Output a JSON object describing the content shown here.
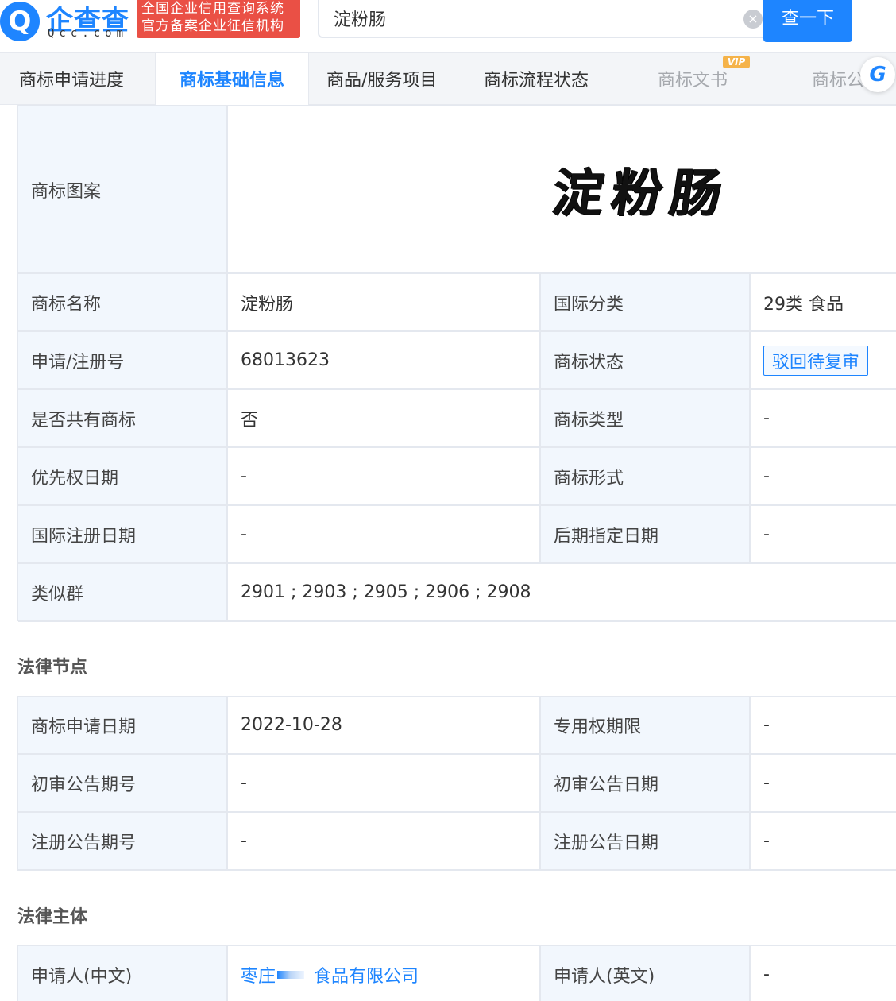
{
  "header": {
    "logo_glyph": "Q",
    "logo_text": "企查查",
    "logo_sub": "Qcc.com",
    "badge_line1": "全国企业信用查询系统",
    "badge_line2": "官方备案企业征信机构",
    "search_value": "淀粉肠",
    "search_button": "查一下",
    "clear_glyph": "×"
  },
  "tabs": {
    "items": [
      {
        "label": "商标申请进度"
      },
      {
        "label": "商标基础信息"
      },
      {
        "label": "商品/服务项目"
      },
      {
        "label": "商标流程状态"
      },
      {
        "label": "商标文书"
      },
      {
        "label": "商标公"
      }
    ],
    "vip_badge": "VIP",
    "assistant_glyph": "G"
  },
  "basic": {
    "pattern_label": "商标图案",
    "pattern_text": "淀粉肠",
    "name_label": "商标名称",
    "name_value": "淀粉肠",
    "intl_class_label": "国际分类",
    "intl_class_value": "29类 食品",
    "reg_no_label": "申请/注册号",
    "reg_no_value": "68013623",
    "status_label": "商标状态",
    "status_value": "驳回待复审",
    "shared_label": "是否共有商标",
    "shared_value": "否",
    "type_label": "商标类型",
    "type_value": "-",
    "priority_label": "优先权日期",
    "priority_value": "-",
    "form_label": "商标形式",
    "form_value": "-",
    "intl_reg_label": "国际注册日期",
    "intl_reg_value": "-",
    "later_label": "后期指定日期",
    "later_value": "-",
    "similar_label": "类似群",
    "similar_value": "2901 ; 2903 ; 2905 ; 2906 ; 2908"
  },
  "legal_nodes": {
    "title": "法律节点",
    "apply_date_label": "商标申请日期",
    "apply_date_value": "2022-10-28",
    "exclusive_label": "专用权期限",
    "exclusive_value": "-",
    "prelim_no_label": "初审公告期号",
    "prelim_no_value": "-",
    "prelim_date_label": "初审公告日期",
    "prelim_date_value": "-",
    "reg_no_label": "注册公告期号",
    "reg_no_value": "-",
    "reg_date_label": "注册公告日期",
    "reg_date_value": "-"
  },
  "legal_subject": {
    "title": "法律主体",
    "applicant_cn_label": "申请人(中文)",
    "applicant_cn_prefix": "枣庄",
    "applicant_cn_suffix": "食品有限公司",
    "applicant_en_label": "申请人(英文)",
    "applicant_en_value": "-"
  },
  "colors": {
    "accent": "#1e85ff",
    "badge_red": "#ea5045",
    "label_bg": "#f2f7fd",
    "border": "#e4e8ef"
  }
}
